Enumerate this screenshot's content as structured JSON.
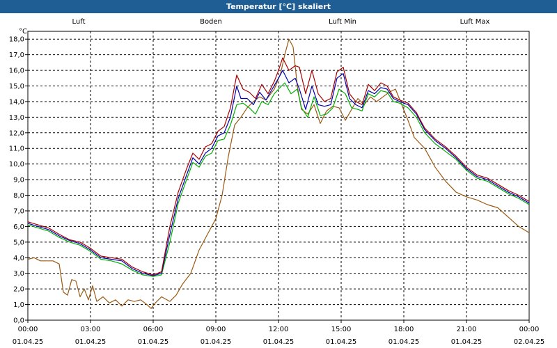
{
  "window": {
    "title": "Temperatur [°C] skaliert"
  },
  "chart_data": {
    "type": "line",
    "title": "Temperatur [°C] skaliert",
    "ylabel": "°C",
    "ylim": [
      0,
      18.5
    ],
    "yticks": [
      0.0,
      1.0,
      2.0,
      3.0,
      4.0,
      5.0,
      6.0,
      7.0,
      8.0,
      9.0,
      10.0,
      11.0,
      12.0,
      13.0,
      14.0,
      15.0,
      16.0,
      17.0,
      18.0
    ],
    "ytick_labels": [
      "0,0",
      "1,0",
      "2,0",
      "3,0",
      "4,0",
      "5,0",
      "6,0",
      "7,0",
      "8,0",
      "9,0",
      "10,0",
      "11,0",
      "12,0",
      "13,0",
      "14,0",
      "15,0",
      "16,0",
      "17,0",
      "18,0"
    ],
    "xlim": [
      0,
      24
    ],
    "xticks": [
      0,
      3,
      6,
      9,
      12,
      15,
      18,
      21,
      24
    ],
    "xtick_labels": [
      [
        "00:00",
        "01.04.25"
      ],
      [
        "03:00",
        "01.04.25"
      ],
      [
        "06:00",
        "01.04.25"
      ],
      [
        "09:00",
        "01.04.25"
      ],
      [
        "12:00",
        "01.04.25"
      ],
      [
        "15:00",
        "01.04.25"
      ],
      [
        "18:00",
        "01.04.25"
      ],
      [
        "21:00",
        "01.04.25"
      ],
      [
        "00:00",
        "02.04.25"
      ]
    ],
    "grid": true,
    "legend": "top",
    "series": [
      {
        "name": "Luft",
        "color": "#0000b0",
        "points": [
          [
            0,
            6.2
          ],
          [
            0.5,
            6.0
          ],
          [
            1,
            5.8
          ],
          [
            1.5,
            5.4
          ],
          [
            2,
            5.1
          ],
          [
            2.5,
            4.9
          ],
          [
            3,
            4.5
          ],
          [
            3.5,
            4.0
          ],
          [
            4,
            3.9
          ],
          [
            4.5,
            3.8
          ],
          [
            5,
            3.3
          ],
          [
            5.5,
            3.0
          ],
          [
            6,
            2.85
          ],
          [
            6.4,
            3.0
          ],
          [
            6.8,
            5.5
          ],
          [
            7.2,
            7.8
          ],
          [
            7.6,
            9.3
          ],
          [
            7.9,
            10.4
          ],
          [
            8.2,
            10.0
          ],
          [
            8.5,
            10.7
          ],
          [
            8.8,
            11.0
          ],
          [
            9.1,
            11.8
          ],
          [
            9.4,
            12.0
          ],
          [
            9.7,
            13.0
          ],
          [
            10,
            15.0
          ],
          [
            10.2,
            14.2
          ],
          [
            10.5,
            14.2
          ],
          [
            10.8,
            13.8
          ],
          [
            11.1,
            14.6
          ],
          [
            11.4,
            14.1
          ],
          [
            11.7,
            14.8
          ],
          [
            12,
            15.5
          ],
          [
            12.2,
            16.0
          ],
          [
            12.5,
            15.2
          ],
          [
            12.8,
            15.5
          ],
          [
            13,
            14.8
          ],
          [
            13.3,
            13.5
          ],
          [
            13.6,
            15.0
          ],
          [
            13.9,
            13.8
          ],
          [
            14.2,
            13.7
          ],
          [
            14.5,
            13.8
          ],
          [
            14.8,
            15.5
          ],
          [
            15.1,
            15.8
          ],
          [
            15.4,
            14.2
          ],
          [
            15.7,
            13.8
          ],
          [
            16,
            13.6
          ],
          [
            16.3,
            14.7
          ],
          [
            16.6,
            14.5
          ],
          [
            16.9,
            14.9
          ],
          [
            17.2,
            14.8
          ],
          [
            17.5,
            14.2
          ],
          [
            17.8,
            14.0
          ],
          [
            18.2,
            13.8
          ],
          [
            18.6,
            13.2
          ],
          [
            19,
            12.2
          ],
          [
            19.5,
            11.5
          ],
          [
            20,
            11.0
          ],
          [
            20.5,
            10.4
          ],
          [
            21,
            9.7
          ],
          [
            21.5,
            9.2
          ],
          [
            22,
            9.0
          ],
          [
            22.5,
            8.6
          ],
          [
            23,
            8.2
          ],
          [
            23.5,
            7.9
          ],
          [
            24,
            7.5
          ]
        ]
      },
      {
        "name": "Boden",
        "color": "#9a5a14",
        "points": [
          [
            0,
            3.9
          ],
          [
            0.3,
            4.0
          ],
          [
            0.6,
            3.8
          ],
          [
            1.2,
            3.8
          ],
          [
            1.5,
            3.6
          ],
          [
            1.7,
            1.8
          ],
          [
            1.9,
            1.6
          ],
          [
            2.1,
            2.6
          ],
          [
            2.3,
            2.5
          ],
          [
            2.5,
            1.5
          ],
          [
            2.7,
            2.0
          ],
          [
            2.9,
            1.3
          ],
          [
            3.1,
            2.2
          ],
          [
            3.3,
            1.2
          ],
          [
            3.6,
            1.5
          ],
          [
            3.9,
            1.1
          ],
          [
            4.2,
            1.3
          ],
          [
            4.5,
            0.9
          ],
          [
            4.8,
            1.3
          ],
          [
            5.1,
            1.2
          ],
          [
            5.4,
            1.3
          ],
          [
            5.7,
            1.0
          ],
          [
            5.9,
            0.75
          ],
          [
            6.1,
            1.1
          ],
          [
            6.4,
            1.5
          ],
          [
            6.8,
            1.2
          ],
          [
            7.1,
            1.6
          ],
          [
            7.4,
            2.3
          ],
          [
            7.8,
            3.0
          ],
          [
            8.2,
            4.5
          ],
          [
            8.6,
            5.5
          ],
          [
            9,
            6.5
          ],
          [
            9.3,
            8.0
          ],
          [
            9.6,
            10.5
          ],
          [
            9.9,
            12.5
          ],
          [
            10.2,
            13.0
          ],
          [
            10.5,
            13.6
          ],
          [
            10.8,
            14.0
          ],
          [
            11.1,
            14.3
          ],
          [
            11.4,
            14.1
          ],
          [
            11.8,
            14.8
          ],
          [
            12.1,
            15.8
          ],
          [
            12.3,
            17.0
          ],
          [
            12.5,
            18.0
          ],
          [
            12.7,
            17.5
          ],
          [
            12.9,
            15.0
          ],
          [
            13.1,
            13.5
          ],
          [
            13.4,
            13.2
          ],
          [
            13.7,
            13.8
          ],
          [
            14,
            12.6
          ],
          [
            14.3,
            13.4
          ],
          [
            14.6,
            13.7
          ],
          [
            14.9,
            13.6
          ],
          [
            15.2,
            12.8
          ],
          [
            15.5,
            13.5
          ],
          [
            15.8,
            14.2
          ],
          [
            16.1,
            13.8
          ],
          [
            16.4,
            14.3
          ],
          [
            16.7,
            14.0
          ],
          [
            17,
            14.3
          ],
          [
            17.3,
            14.6
          ],
          [
            17.6,
            14.8
          ],
          [
            17.9,
            13.8
          ],
          [
            18.2,
            12.8
          ],
          [
            18.5,
            11.7
          ],
          [
            19,
            11.0
          ],
          [
            19.5,
            9.8
          ],
          [
            20,
            8.9
          ],
          [
            20.5,
            8.2
          ],
          [
            21,
            7.9
          ],
          [
            21.5,
            7.7
          ],
          [
            22,
            7.4
          ],
          [
            22.5,
            7.2
          ],
          [
            23,
            6.6
          ],
          [
            23.5,
            6.0
          ],
          [
            24,
            5.6
          ]
        ]
      },
      {
        "name": "Luft Min",
        "color": "#00b000",
        "points": [
          [
            0,
            6.1
          ],
          [
            0.5,
            5.9
          ],
          [
            1,
            5.7
          ],
          [
            1.5,
            5.3
          ],
          [
            2,
            5.0
          ],
          [
            2.5,
            4.8
          ],
          [
            3,
            4.4
          ],
          [
            3.5,
            3.9
          ],
          [
            4,
            3.8
          ],
          [
            4.5,
            3.6
          ],
          [
            5,
            3.2
          ],
          [
            5.5,
            2.9
          ],
          [
            6,
            2.8
          ],
          [
            6.4,
            2.9
          ],
          [
            6.8,
            5.0
          ],
          [
            7.2,
            7.5
          ],
          [
            7.6,
            9.0
          ],
          [
            7.9,
            10.1
          ],
          [
            8.2,
            9.8
          ],
          [
            8.5,
            10.5
          ],
          [
            8.8,
            10.7
          ],
          [
            9.1,
            11.5
          ],
          [
            9.4,
            11.6
          ],
          [
            9.7,
            12.5
          ],
          [
            10,
            13.8
          ],
          [
            10.3,
            13.9
          ],
          [
            10.6,
            13.6
          ],
          [
            10.9,
            13.2
          ],
          [
            11.2,
            14.0
          ],
          [
            11.5,
            13.8
          ],
          [
            11.8,
            14.5
          ],
          [
            12,
            14.8
          ],
          [
            12.3,
            15.2
          ],
          [
            12.6,
            14.5
          ],
          [
            12.9,
            14.8
          ],
          [
            13.1,
            13.6
          ],
          [
            13.4,
            13.0
          ],
          [
            13.7,
            14.3
          ],
          [
            14,
            13.1
          ],
          [
            14.3,
            13.2
          ],
          [
            14.6,
            13.6
          ],
          [
            14.9,
            14.8
          ],
          [
            15.2,
            14.5
          ],
          [
            15.5,
            13.6
          ],
          [
            15.8,
            13.5
          ],
          [
            16,
            13.4
          ],
          [
            16.3,
            14.5
          ],
          [
            16.6,
            14.3
          ],
          [
            16.9,
            14.7
          ],
          [
            17.2,
            14.6
          ],
          [
            17.5,
            14.0
          ],
          [
            17.8,
            13.9
          ],
          [
            18.2,
            13.6
          ],
          [
            18.6,
            13.0
          ],
          [
            19,
            12.0
          ],
          [
            19.5,
            11.3
          ],
          [
            20,
            10.8
          ],
          [
            20.5,
            10.3
          ],
          [
            21,
            9.6
          ],
          [
            21.5,
            9.1
          ],
          [
            22,
            8.9
          ],
          [
            22.5,
            8.5
          ],
          [
            23,
            8.1
          ],
          [
            23.5,
            7.8
          ],
          [
            24,
            7.4
          ]
        ]
      },
      {
        "name": "Luft Max",
        "color": "#a80000",
        "points": [
          [
            0,
            6.3
          ],
          [
            0.5,
            6.1
          ],
          [
            1,
            5.9
          ],
          [
            1.5,
            5.5
          ],
          [
            2,
            5.15
          ],
          [
            2.5,
            5.0
          ],
          [
            3,
            4.6
          ],
          [
            3.5,
            4.1
          ],
          [
            4,
            4.0
          ],
          [
            4.5,
            3.9
          ],
          [
            5,
            3.4
          ],
          [
            5.5,
            3.1
          ],
          [
            6,
            2.9
          ],
          [
            6.4,
            3.1
          ],
          [
            6.8,
            6.0
          ],
          [
            7.2,
            8.2
          ],
          [
            7.6,
            9.7
          ],
          [
            7.9,
            10.7
          ],
          [
            8.2,
            10.3
          ],
          [
            8.5,
            11.1
          ],
          [
            8.8,
            11.3
          ],
          [
            9.1,
            12.1
          ],
          [
            9.4,
            12.4
          ],
          [
            9.7,
            13.6
          ],
          [
            10,
            15.7
          ],
          [
            10.3,
            14.8
          ],
          [
            10.6,
            14.6
          ],
          [
            10.9,
            14.2
          ],
          [
            11.2,
            15.1
          ],
          [
            11.5,
            14.5
          ],
          [
            11.8,
            15.3
          ],
          [
            12,
            16.0
          ],
          [
            12.2,
            16.8
          ],
          [
            12.5,
            16.0
          ],
          [
            12.8,
            16.3
          ],
          [
            13.0,
            16.2
          ],
          [
            13.3,
            14.5
          ],
          [
            13.6,
            16.0
          ],
          [
            13.9,
            14.5
          ],
          [
            14.2,
            14.0
          ],
          [
            14.5,
            14.2
          ],
          [
            14.8,
            15.9
          ],
          [
            15.1,
            16.2
          ],
          [
            15.4,
            14.5
          ],
          [
            15.7,
            14.0
          ],
          [
            16,
            13.8
          ],
          [
            16.3,
            15.1
          ],
          [
            16.6,
            14.7
          ],
          [
            16.9,
            15.2
          ],
          [
            17.2,
            15.0
          ],
          [
            17.5,
            14.3
          ],
          [
            17.8,
            14.1
          ],
          [
            18.2,
            13.9
          ],
          [
            18.6,
            13.3
          ],
          [
            19,
            12.3
          ],
          [
            19.5,
            11.6
          ],
          [
            20,
            11.1
          ],
          [
            20.5,
            10.5
          ],
          [
            21,
            9.8
          ],
          [
            21.5,
            9.3
          ],
          [
            22,
            9.1
          ],
          [
            22.5,
            8.7
          ],
          [
            23,
            8.3
          ],
          [
            23.5,
            8.0
          ],
          [
            24,
            7.6
          ]
        ]
      }
    ]
  }
}
